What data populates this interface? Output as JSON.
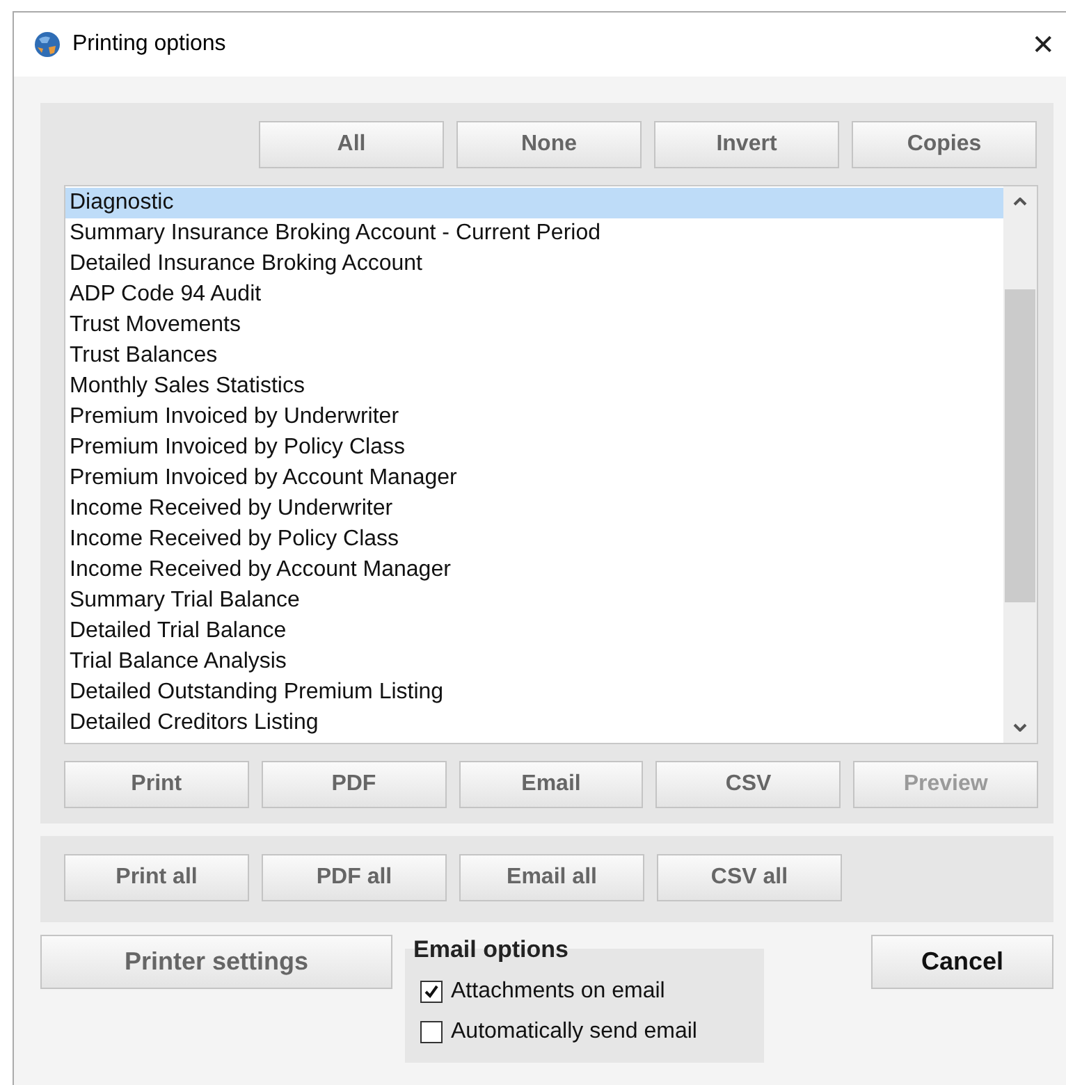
{
  "window": {
    "title": "Printing options",
    "close": "✕"
  },
  "select_buttons": [
    {
      "label": "All",
      "disabled": false
    },
    {
      "label": "None",
      "disabled": false
    },
    {
      "label": "Invert",
      "disabled": false
    },
    {
      "label": "Copies",
      "disabled": false
    }
  ],
  "report_list": [
    {
      "label": "Diagnostic",
      "selected": true
    },
    {
      "label": "Summary Insurance Broking Account - Current Period",
      "selected": false
    },
    {
      "label": "Detailed Insurance Broking Account",
      "selected": false
    },
    {
      "label": "ADP Code 94 Audit",
      "selected": false
    },
    {
      "label": "Trust Movements",
      "selected": false
    },
    {
      "label": "Trust Balances",
      "selected": false
    },
    {
      "label": "Monthly Sales Statistics",
      "selected": false
    },
    {
      "label": "Premium Invoiced by Underwriter",
      "selected": false
    },
    {
      "label": "Premium Invoiced by Policy Class",
      "selected": false
    },
    {
      "label": "Premium Invoiced by Account Manager",
      "selected": false
    },
    {
      "label": "Income Received by Underwriter",
      "selected": false
    },
    {
      "label": "Income Received by Policy Class",
      "selected": false
    },
    {
      "label": "Income Received by Account Manager",
      "selected": false
    },
    {
      "label": "Summary Trial Balance",
      "selected": false
    },
    {
      "label": "Detailed Trial Balance",
      "selected": false
    },
    {
      "label": "Trial Balance Analysis",
      "selected": false
    },
    {
      "label": "Detailed Outstanding Premium Listing",
      "selected": false
    },
    {
      "label": "Detailed Creditors Listing",
      "selected": false
    }
  ],
  "output_buttons": [
    {
      "label": "Print",
      "disabled": false
    },
    {
      "label": "PDF",
      "disabled": false
    },
    {
      "label": "Email",
      "disabled": false
    },
    {
      "label": "CSV",
      "disabled": false
    },
    {
      "label": "Preview",
      "disabled": true
    }
  ],
  "all_buttons": [
    {
      "label": "Print all",
      "disabled": false
    },
    {
      "label": "PDF all",
      "disabled": false
    },
    {
      "label": "Email all",
      "disabled": false
    },
    {
      "label": "CSV all",
      "disabled": false
    }
  ],
  "printer_settings": "Printer settings",
  "email_options": {
    "title": "Email options",
    "options": [
      {
        "label": "Attachments on email",
        "checked": true
      },
      {
        "label": "Automatically send email",
        "checked": false
      }
    ]
  },
  "cancel": "Cancel"
}
